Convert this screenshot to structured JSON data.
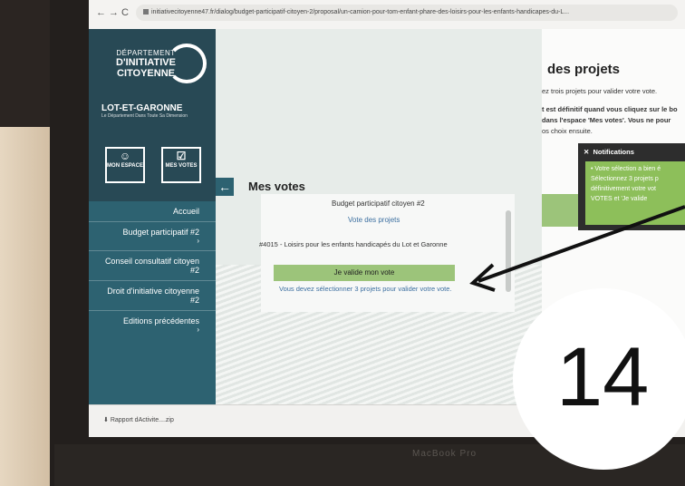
{
  "browser": {
    "url": "initiativecitoyenne47.fr/dialog/budget-participatif-citoyen-2/proposal/un-camion-pour-tom-enfant-phare-des-loisirs-pour-les-enfants-handicapes-du-L..."
  },
  "sidebar": {
    "logo_line1": "DÉPARTEMENT",
    "logo_line2": "D'INITIATIVE",
    "logo_line3": "CITOYENNE",
    "region": "LOT-ET-GARONNE",
    "region_sub": "Le Département Dans Toute Sa Dimension",
    "mon_espace": "MON ESPACE",
    "mes_votes": "MES VOTES",
    "menu": [
      {
        "label": "Accueil"
      },
      {
        "label": "Budget participatif #2",
        "chev": "›"
      },
      {
        "label": "Conseil consultatif citoyen #2"
      },
      {
        "label": "Droit d'initiative citoyenne #2"
      },
      {
        "label": "Editions précédentes",
        "chev": "›"
      }
    ]
  },
  "main": {
    "title": "Mes votes",
    "budget": "Budget participatif citoyen #2",
    "vote_link": "Vote des projets",
    "project": "#4015 - Loisirs pour les enfants handicapés du Lot et Garonne",
    "validate_button": "Je valide mon vote",
    "warning": "Vous devez sélectionner 3 projets pour valider votre vote."
  },
  "right_panel": {
    "title": "des projets",
    "text1": "ez trois projets pour valider votre vote.",
    "text2": "t est définitif quand vous cliquez sur le bo",
    "text3": "dans l'espace 'Mes votes'. Vous ne pour",
    "text4": "os choix ensuite."
  },
  "notification": {
    "header": "Notifications",
    "line1": "• Votre sélection a bien é",
    "line2": "Sélectionnez 3 projets p",
    "line3": "définitivement votre vot",
    "line4": "VOTES et 'Je valide"
  },
  "download": {
    "label": "Rapport dActivite....zip"
  },
  "laptop": {
    "brand": "MacBook Pro"
  },
  "badge": {
    "number": "14"
  }
}
